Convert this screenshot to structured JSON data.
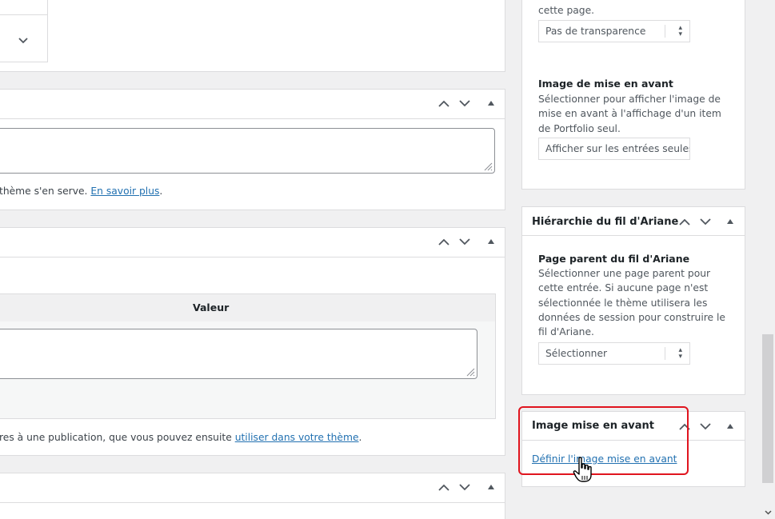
{
  "left": {
    "panel_b": {
      "helper_prefix": "thème s'en serve.",
      "helper_link": "En savoir plus",
      "helper_suffix": "."
    },
    "panel_c": {
      "column_header": "Valeur",
      "footer_prefix": "res à une publication, que vous pouvez ensuite",
      "footer_link": "utiliser dans votre thème",
      "footer_suffix": "."
    }
  },
  "right": {
    "top": {
      "desc_tail": "cette page.",
      "select_value": "Pas de transparence",
      "featured_label": "Image de mise en avant",
      "featured_desc": "Sélectionner pour afficher l'image de mise en avant à l'affichage d'un item de Portfolio seul.",
      "featured_select": "Afficher sur les entrées seules"
    },
    "breadcrumb": {
      "title": "Hiérarchie du fil d'Ariane",
      "label": "Page parent du fil d'Ariane",
      "desc": "Sélectionner une page parent pour cette entrée. Si aucune page n'est sélectionnée le thème utilisera les données de session pour construire le fil d'Ariane.",
      "select": "Sélectionner"
    },
    "featured_image": {
      "title": "Image mise en avant",
      "link": "Définir l'image mise en avant"
    }
  },
  "colors": {
    "highlight": "#e0141e",
    "link": "#2271b1",
    "background": "#f0f0f1"
  },
  "icons": [
    "chevron-up-icon",
    "chevron-down-icon",
    "triangle-toggle-icon",
    "hand-cursor-icon",
    "resize-grip-icon"
  ]
}
